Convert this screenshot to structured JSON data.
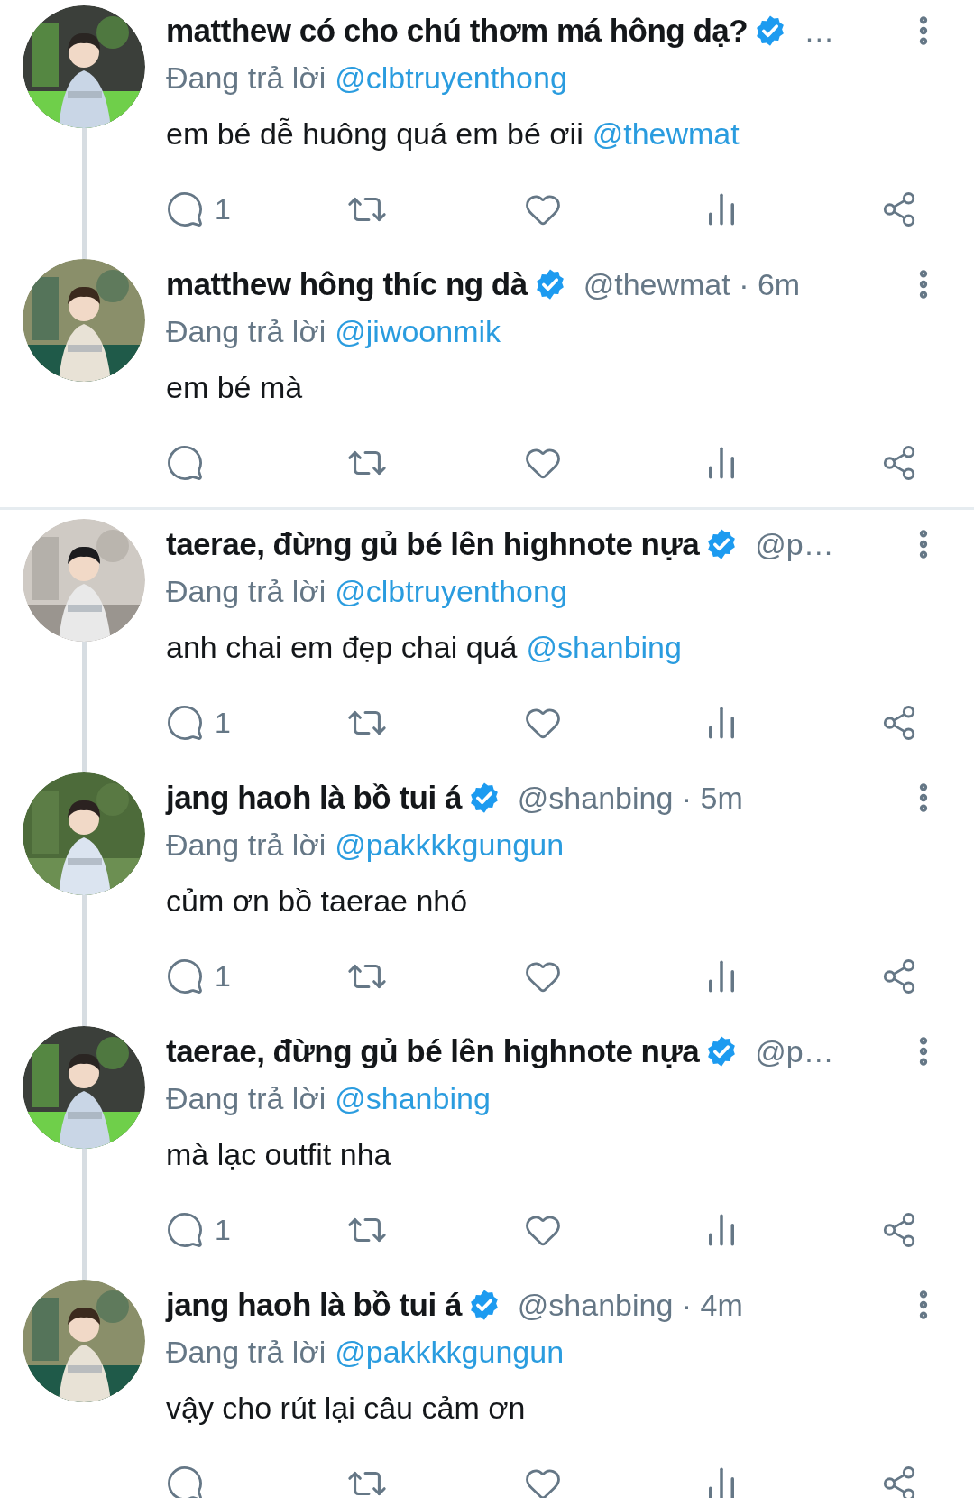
{
  "threads": [
    {
      "tweets": [
        {
          "name": "matthew có cho chú thơm má hông dạ?",
          "verified": true,
          "handle": "…",
          "reply_label": "Đang trả lời",
          "reply_to": "@clbtruyenthong",
          "text": "em bé dễ huông quá em bé ơii",
          "mention": "@thewmat",
          "reply_count": "1"
        },
        {
          "name": "matthew hông thíc ng dà",
          "verified": true,
          "handle": "@thewmat · 6m",
          "reply_label": "Đang trả lời",
          "reply_to": "@jiwoonmik",
          "text": "em bé mà"
        }
      ]
    },
    {
      "tweets": [
        {
          "name": "taerae, đừng gủ bé lên highnote nựa",
          "verified": true,
          "handle": "@p…",
          "reply_label": "Đang trả lời",
          "reply_to": "@clbtruyenthong",
          "text": "anh chai em đẹp chai quá",
          "mention": "@shanbing",
          "reply_count": "1"
        },
        {
          "name": "jang haoh là bồ tui á",
          "verified": true,
          "handle": "@shanbing · 5m",
          "reply_label": "Đang trả lời",
          "reply_to": "@pakkkkgungun",
          "text": "củm ơn bồ taerae nhó",
          "reply_count": "1"
        },
        {
          "name": "taerae, đừng gủ bé lên highnote nựa",
          "verified": true,
          "handle": "@p…",
          "reply_label": "Đang trả lời",
          "reply_to": "@shanbing",
          "text": "mà lạc outfit nha",
          "reply_count": "1"
        },
        {
          "name": "jang haoh là bồ tui á",
          "verified": true,
          "handle": "@shanbing · 4m",
          "reply_label": "Đang trả lời",
          "reply_to": "@pakkkkgungun",
          "text": "vậy cho rút lại câu cảm ơn"
        }
      ]
    }
  ]
}
